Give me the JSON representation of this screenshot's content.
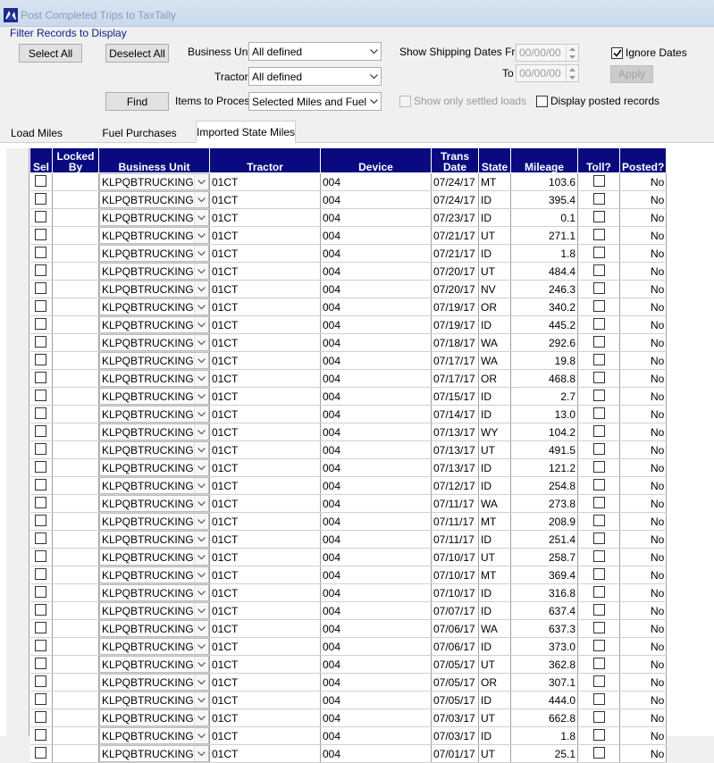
{
  "window": {
    "title": "Post Completed Trips to TaxTally"
  },
  "filter": {
    "caption": "Filter Records to Display",
    "select_all": "Select All",
    "deselect_all": "Deselect All",
    "find": "Find",
    "business_unit_label": "Business Unit",
    "business_unit_value": "All defined",
    "tractor_label": "Tractor",
    "tractor_value": "All defined",
    "items_label": "Items to Process",
    "items_value": "Selected Miles and Fuel",
    "ship_from_label": "Show Shipping Dates From",
    "ship_from_value": "00/00/00",
    "to_label": "To",
    "to_value": "00/00/00",
    "ignore_dates_label": "Ignore Dates",
    "ignore_dates_checked": true,
    "apply": "Apply",
    "settled_label": "Show only settled loads",
    "posted_label": "Display posted records"
  },
  "tabs": [
    {
      "label": "Load Miles",
      "active": false
    },
    {
      "label": "Fuel Purchases",
      "active": false
    },
    {
      "label": "Imported State Miles",
      "active": true
    }
  ],
  "grid": {
    "headers": {
      "sel": "Sel",
      "locked_by": "Locked By",
      "business_unit": "Business Unit",
      "tractor": "Tractor",
      "device": "Device",
      "trans_date": "Trans Date",
      "state": "State",
      "mileage": "Mileage",
      "toll": "Toll?",
      "posted": "Posted?"
    },
    "rows": [
      {
        "bu": "KLPQBTRUCKING",
        "tractor": "01CT",
        "device": "004",
        "date": "07/24/17",
        "state": "MT",
        "mileage": "103.6",
        "posted": "No"
      },
      {
        "bu": "KLPQBTRUCKING",
        "tractor": "01CT",
        "device": "004",
        "date": "07/24/17",
        "state": "ID",
        "mileage": "395.4",
        "posted": "No"
      },
      {
        "bu": "KLPQBTRUCKING",
        "tractor": "01CT",
        "device": "004",
        "date": "07/23/17",
        "state": "ID",
        "mileage": "0.1",
        "posted": "No"
      },
      {
        "bu": "KLPQBTRUCKING",
        "tractor": "01CT",
        "device": "004",
        "date": "07/21/17",
        "state": "UT",
        "mileage": "271.1",
        "posted": "No"
      },
      {
        "bu": "KLPQBTRUCKING",
        "tractor": "01CT",
        "device": "004",
        "date": "07/21/17",
        "state": "ID",
        "mileage": "1.8",
        "posted": "No"
      },
      {
        "bu": "KLPQBTRUCKING",
        "tractor": "01CT",
        "device": "004",
        "date": "07/20/17",
        "state": "UT",
        "mileage": "484.4",
        "posted": "No"
      },
      {
        "bu": "KLPQBTRUCKING",
        "tractor": "01CT",
        "device": "004",
        "date": "07/20/17",
        "state": "NV",
        "mileage": "246.3",
        "posted": "No"
      },
      {
        "bu": "KLPQBTRUCKING",
        "tractor": "01CT",
        "device": "004",
        "date": "07/19/17",
        "state": "OR",
        "mileage": "340.2",
        "posted": "No"
      },
      {
        "bu": "KLPQBTRUCKING",
        "tractor": "01CT",
        "device": "004",
        "date": "07/19/17",
        "state": "ID",
        "mileage": "445.2",
        "posted": "No"
      },
      {
        "bu": "KLPQBTRUCKING",
        "tractor": "01CT",
        "device": "004",
        "date": "07/18/17",
        "state": "WA",
        "mileage": "292.6",
        "posted": "No"
      },
      {
        "bu": "KLPQBTRUCKING",
        "tractor": "01CT",
        "device": "004",
        "date": "07/17/17",
        "state": "WA",
        "mileage": "19.8",
        "posted": "No"
      },
      {
        "bu": "KLPQBTRUCKING",
        "tractor": "01CT",
        "device": "004",
        "date": "07/17/17",
        "state": "OR",
        "mileage": "468.8",
        "posted": "No"
      },
      {
        "bu": "KLPQBTRUCKING",
        "tractor": "01CT",
        "device": "004",
        "date": "07/15/17",
        "state": "ID",
        "mileage": "2.7",
        "posted": "No"
      },
      {
        "bu": "KLPQBTRUCKING",
        "tractor": "01CT",
        "device": "004",
        "date": "07/14/17",
        "state": "ID",
        "mileage": "13.0",
        "posted": "No"
      },
      {
        "bu": "KLPQBTRUCKING",
        "tractor": "01CT",
        "device": "004",
        "date": "07/13/17",
        "state": "WY",
        "mileage": "104.2",
        "posted": "No"
      },
      {
        "bu": "KLPQBTRUCKING",
        "tractor": "01CT",
        "device": "004",
        "date": "07/13/17",
        "state": "UT",
        "mileage": "491.5",
        "posted": "No"
      },
      {
        "bu": "KLPQBTRUCKING",
        "tractor": "01CT",
        "device": "004",
        "date": "07/13/17",
        "state": "ID",
        "mileage": "121.2",
        "posted": "No"
      },
      {
        "bu": "KLPQBTRUCKING",
        "tractor": "01CT",
        "device": "004",
        "date": "07/12/17",
        "state": "ID",
        "mileage": "254.8",
        "posted": "No"
      },
      {
        "bu": "KLPQBTRUCKING",
        "tractor": "01CT",
        "device": "004",
        "date": "07/11/17",
        "state": "WA",
        "mileage": "273.8",
        "posted": "No"
      },
      {
        "bu": "KLPQBTRUCKING",
        "tractor": "01CT",
        "device": "004",
        "date": "07/11/17",
        "state": "MT",
        "mileage": "208.9",
        "posted": "No"
      },
      {
        "bu": "KLPQBTRUCKING",
        "tractor": "01CT",
        "device": "004",
        "date": "07/11/17",
        "state": "ID",
        "mileage": "251.4",
        "posted": "No"
      },
      {
        "bu": "KLPQBTRUCKING",
        "tractor": "01CT",
        "device": "004",
        "date": "07/10/17",
        "state": "UT",
        "mileage": "258.7",
        "posted": "No"
      },
      {
        "bu": "KLPQBTRUCKING",
        "tractor": "01CT",
        "device": "004",
        "date": "07/10/17",
        "state": "MT",
        "mileage": "369.4",
        "posted": "No"
      },
      {
        "bu": "KLPQBTRUCKING",
        "tractor": "01CT",
        "device": "004",
        "date": "07/10/17",
        "state": "ID",
        "mileage": "316.8",
        "posted": "No"
      },
      {
        "bu": "KLPQBTRUCKING",
        "tractor": "01CT",
        "device": "004",
        "date": "07/07/17",
        "state": "ID",
        "mileage": "637.4",
        "posted": "No"
      },
      {
        "bu": "KLPQBTRUCKING",
        "tractor": "01CT",
        "device": "004",
        "date": "07/06/17",
        "state": "WA",
        "mileage": "637.3",
        "posted": "No"
      },
      {
        "bu": "KLPQBTRUCKING",
        "tractor": "01CT",
        "device": "004",
        "date": "07/06/17",
        "state": "ID",
        "mileage": "373.0",
        "posted": "No"
      },
      {
        "bu": "KLPQBTRUCKING",
        "tractor": "01CT",
        "device": "004",
        "date": "07/05/17",
        "state": "UT",
        "mileage": "362.8",
        "posted": "No"
      },
      {
        "bu": "KLPQBTRUCKING",
        "tractor": "01CT",
        "device": "004",
        "date": "07/05/17",
        "state": "OR",
        "mileage": "307.1",
        "posted": "No"
      },
      {
        "bu": "KLPQBTRUCKING",
        "tractor": "01CT",
        "device": "004",
        "date": "07/05/17",
        "state": "ID",
        "mileage": "444.0",
        "posted": "No"
      },
      {
        "bu": "KLPQBTRUCKING",
        "tractor": "01CT",
        "device": "004",
        "date": "07/03/17",
        "state": "UT",
        "mileage": "662.8",
        "posted": "No"
      },
      {
        "bu": "KLPQBTRUCKING",
        "tractor": "01CT",
        "device": "004",
        "date": "07/03/17",
        "state": "ID",
        "mileage": "1.8",
        "posted": "No"
      },
      {
        "bu": "KLPQBTRUCKING",
        "tractor": "01CT",
        "device": "004",
        "date": "07/01/17",
        "state": "UT",
        "mileage": "25.1",
        "posted": "No"
      }
    ]
  },
  "colors": {
    "header_bg": "#0a0a80",
    "title_text": "#8a9db3",
    "caption_text": "#0b1d8a"
  }
}
